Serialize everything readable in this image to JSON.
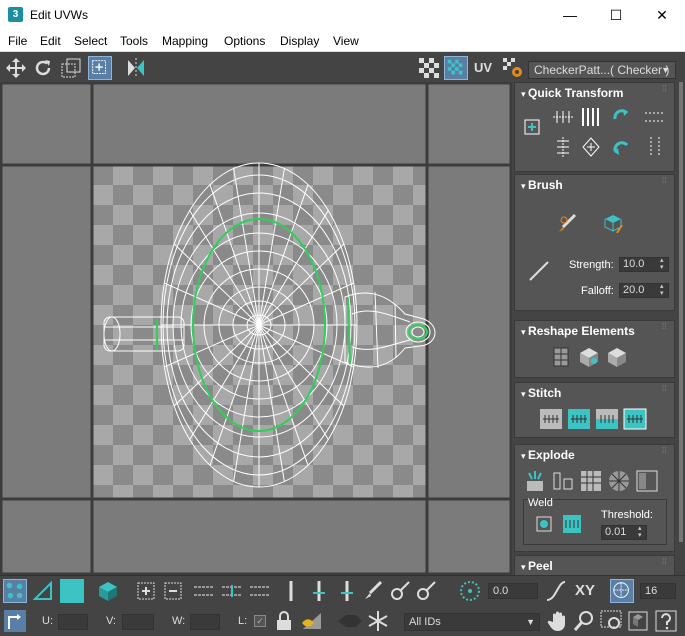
{
  "window": {
    "title": "Edit UVWs",
    "app_icon": "3",
    "minimize": "—",
    "maximize": "☐",
    "close": "✕"
  },
  "menus": [
    "File",
    "Edit",
    "Select",
    "Tools",
    "Mapping",
    "Options",
    "Display",
    "View"
  ],
  "toolbar": {
    "uv_label": "UV",
    "checker_dropdown": "CheckerPatt...( Checker )"
  },
  "panels": {
    "quick_transform": {
      "title": "Quick Transform"
    },
    "brush": {
      "title": "Brush",
      "strength_label": "Strength:",
      "strength_value": "10.0",
      "falloff_label": "Falloff:",
      "falloff_value": "20.0"
    },
    "reshape": {
      "title": "Reshape Elements"
    },
    "stitch": {
      "title": "Stitch"
    },
    "explode": {
      "title": "Explode",
      "weld_label": "Weld",
      "threshold_label": "Threshold:",
      "threshold_value": "0.01"
    },
    "peel": {
      "title": "Peel"
    }
  },
  "bottom": {
    "angle_value": "0.0",
    "xy_label": "XY",
    "grid_value": "16",
    "u_label": "U:",
    "v_label": "V:",
    "w_label": "W:",
    "l_label": "L:",
    "ids_dropdown": "All IDs"
  },
  "colors": {
    "accent": "#3cc3c3",
    "selection_blue": "#5a7fa6",
    "uv_green": "#2fcf5a"
  }
}
